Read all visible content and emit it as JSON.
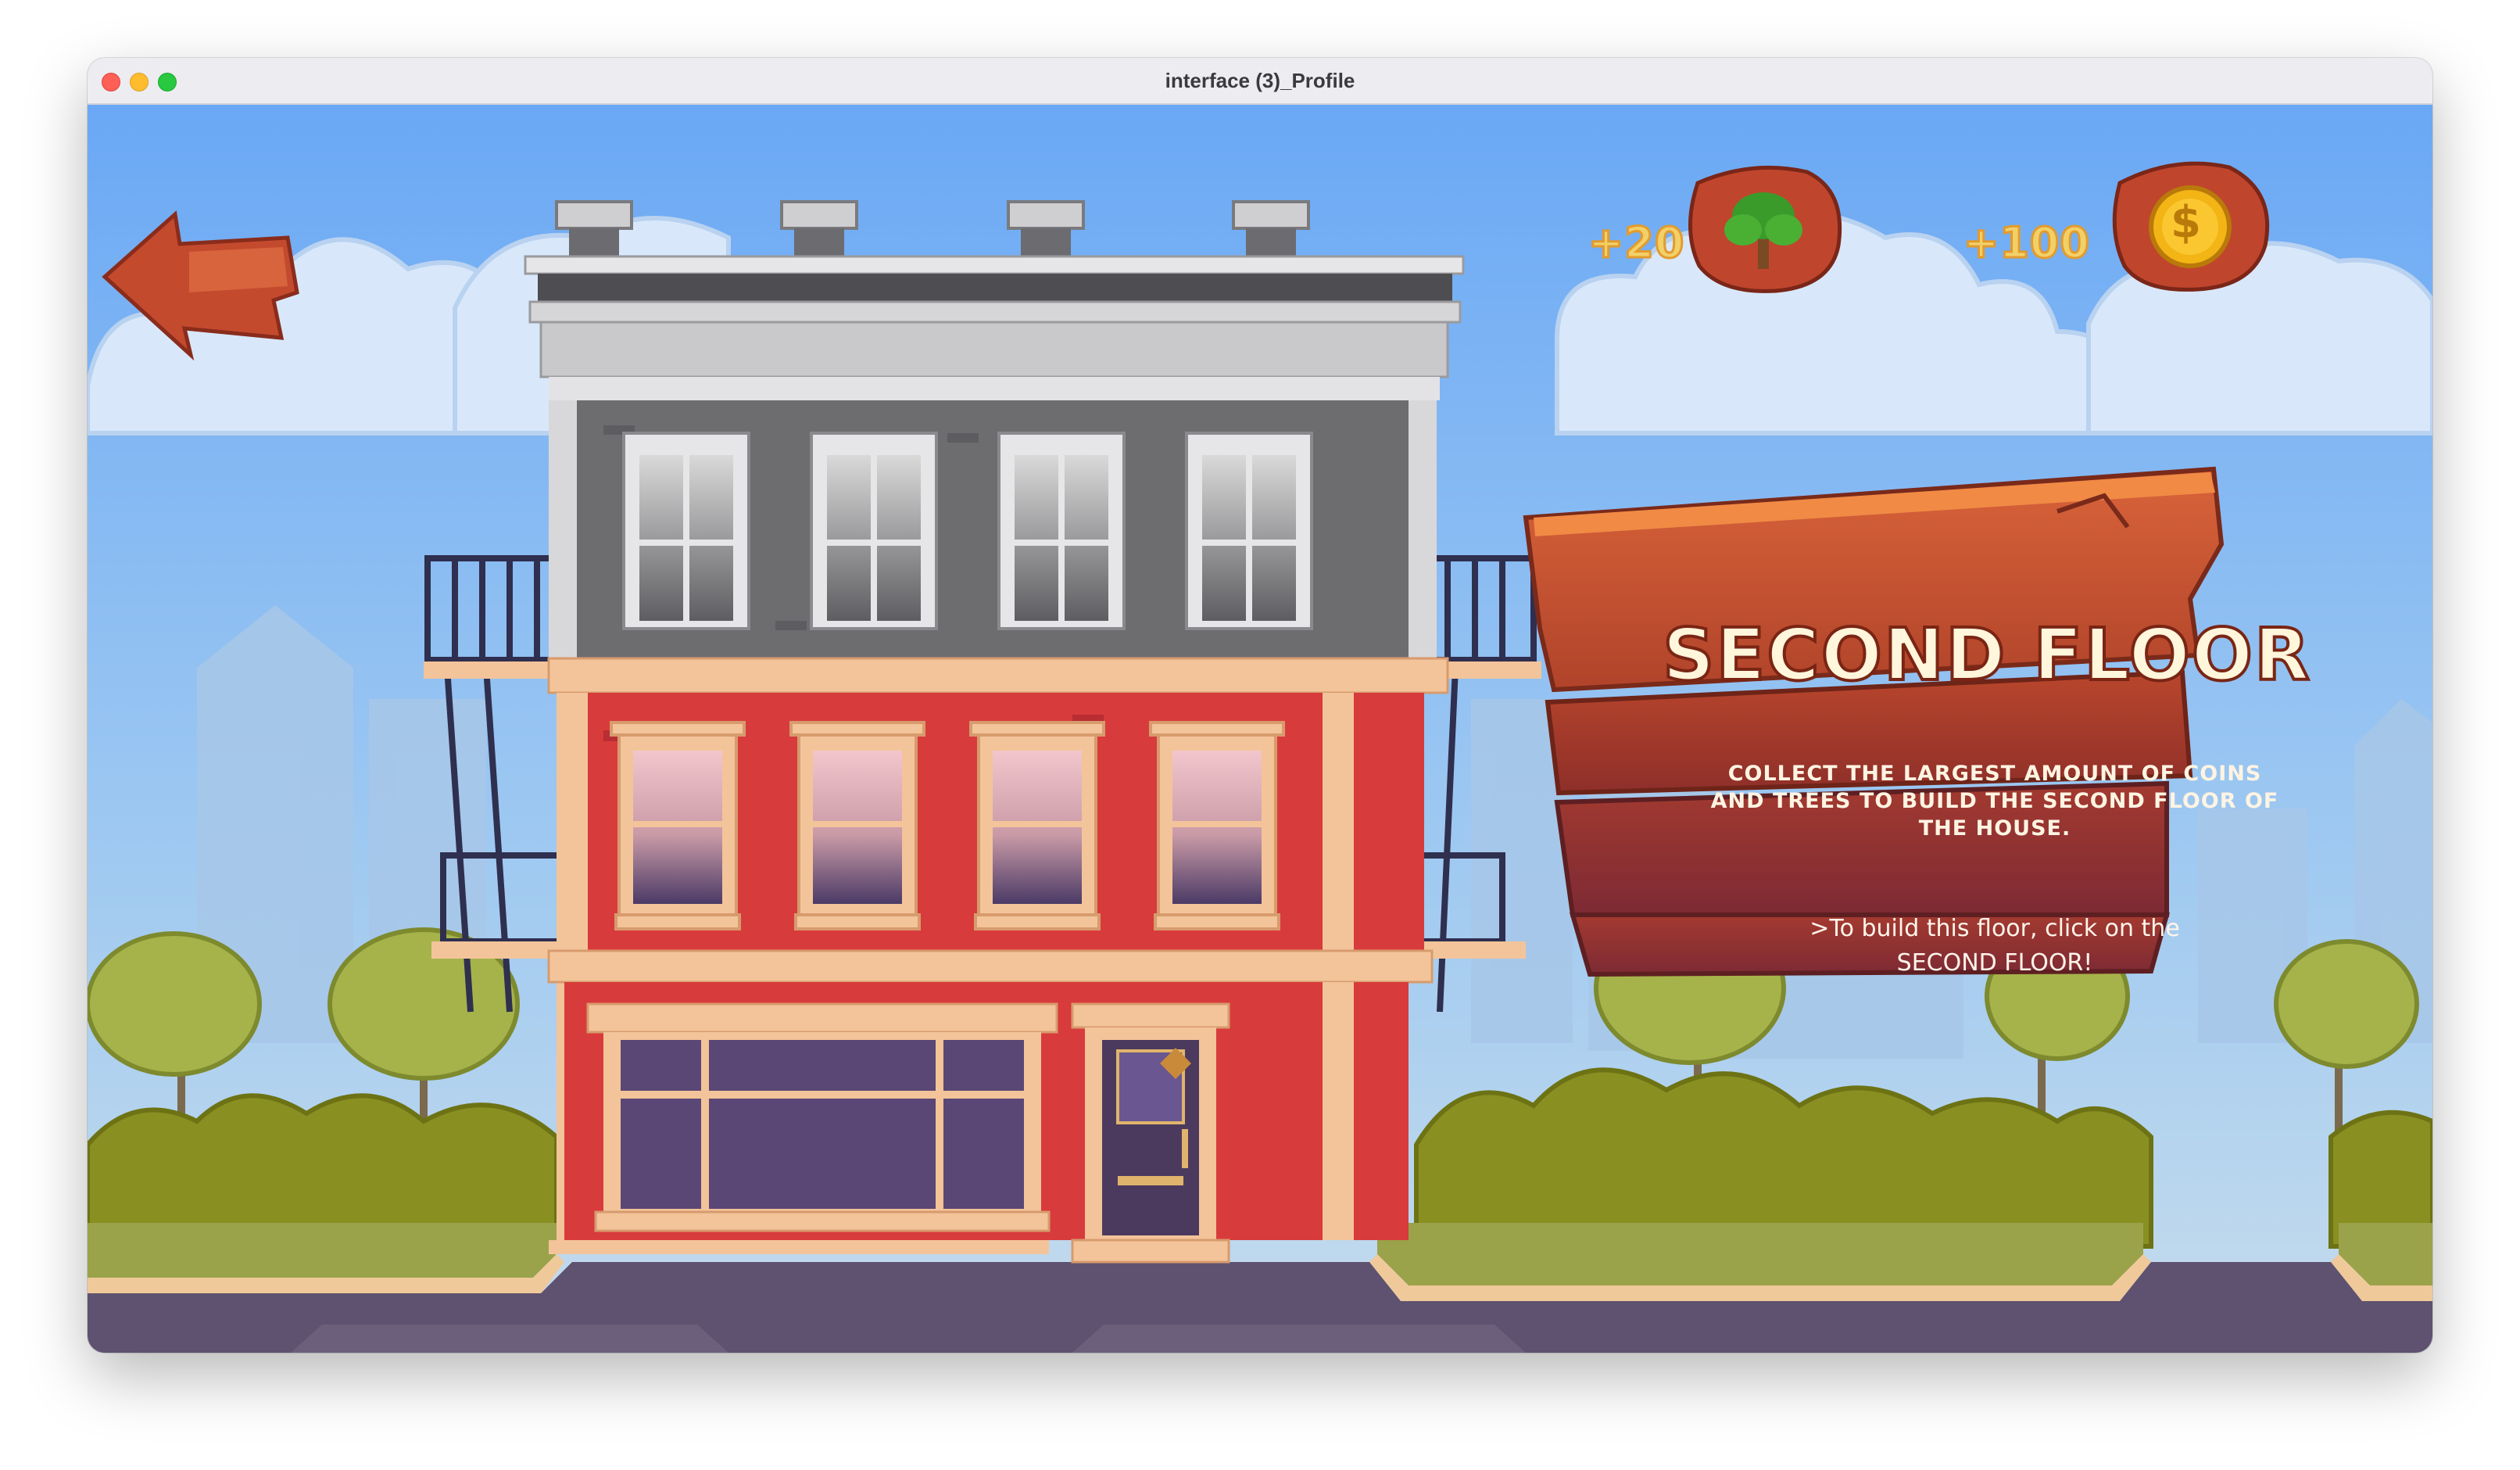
{
  "window": {
    "title": "interface (3)_Profile"
  },
  "hud": {
    "trees_label": "+20",
    "coins_label": "+100",
    "tree_icon": "tree-icon",
    "coin_icon": "coin-icon",
    "coin_symbol": "$"
  },
  "back_button": {
    "icon": "back-arrow-icon"
  },
  "sign": {
    "title": "SECOND FLOOR",
    "description": "COLLECT THE LARGEST AMOUNT OF COINS AND TREES TO BUILD THE SECOND FLOOR OF THE HOUSE.",
    "hint": ">To build this floor, click on the SECOND FLOOR!"
  },
  "colors": {
    "sky": "#7fb4f0",
    "brick_red": "#d83b3b",
    "gray_floor": "#6d6d70",
    "wood": "#c8502d",
    "hud_text": "#f2d068"
  }
}
